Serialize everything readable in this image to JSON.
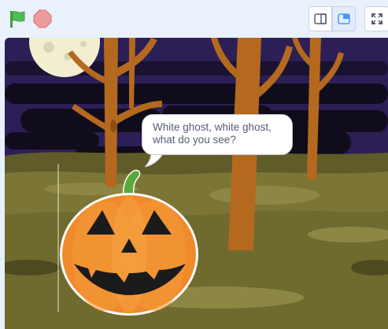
{
  "toolbar": {
    "green_flag_icon": "green-flag-icon",
    "stop_icon": "stop-sign-icon",
    "layout_buttons": [
      {
        "name": "small-stage-button",
        "icon": "small-stage-icon"
      },
      {
        "name": "normal-stage-button",
        "icon": "normal-stage-icon",
        "selected": true
      },
      {
        "name": "fullscreen-button",
        "icon": "fullscreen-icon"
      }
    ],
    "accent_color": "#4c97ff"
  },
  "stage": {
    "sprite": "pumpkin",
    "speech": {
      "line1": "White ghost, white ghost,",
      "line2": "what do you see?"
    }
  }
}
